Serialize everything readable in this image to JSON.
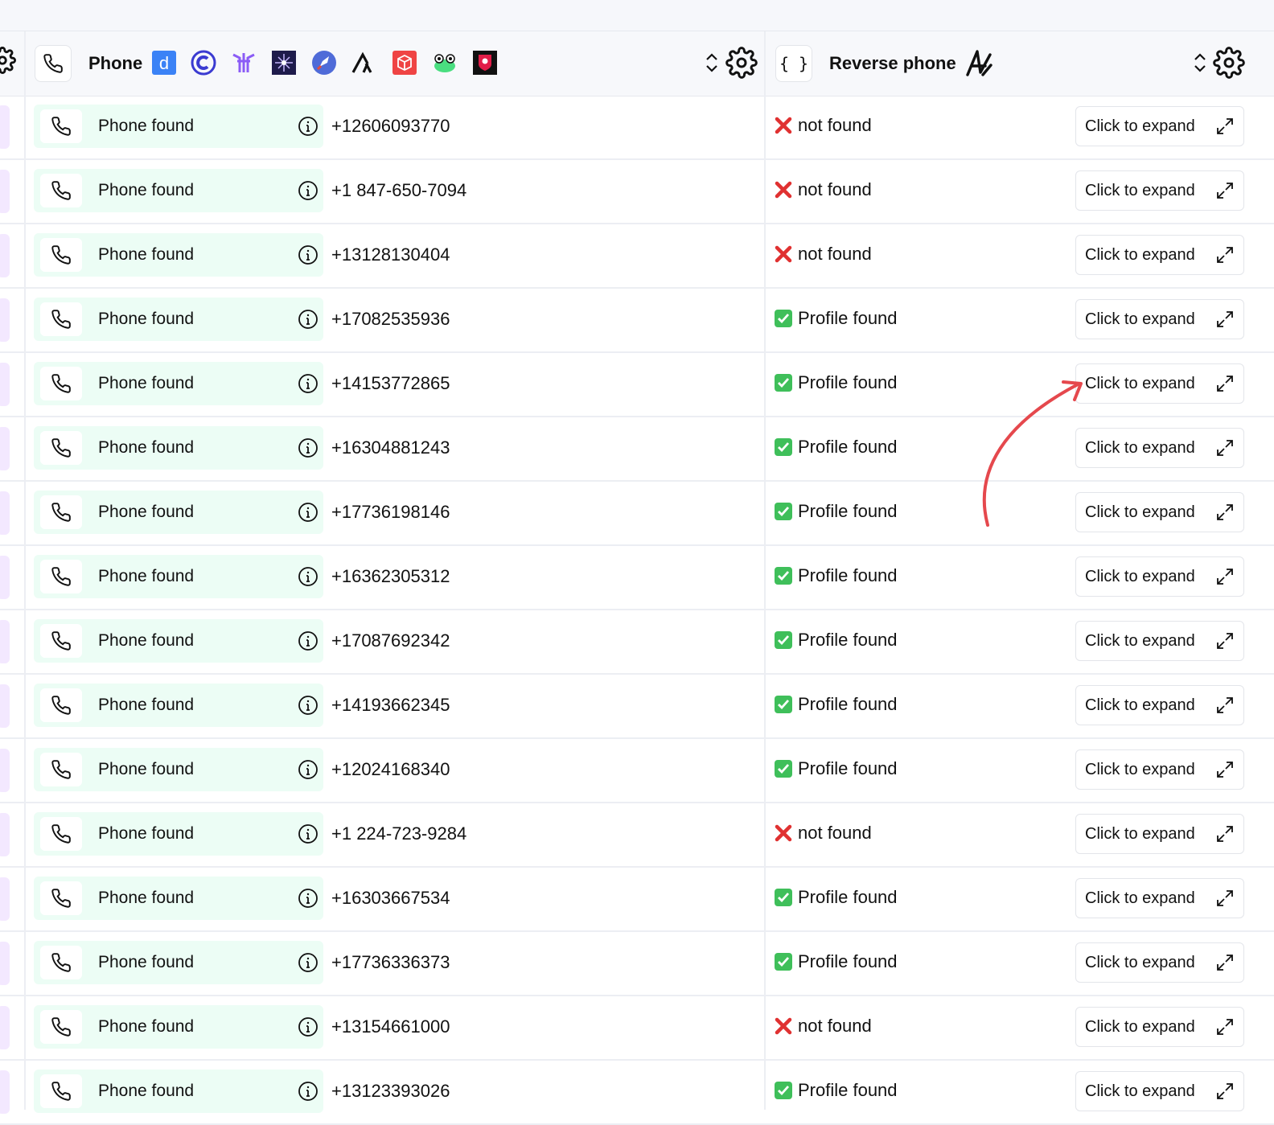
{
  "header": {
    "phone_title": "Phone",
    "reverse_title": "Reverse phone",
    "providers": [
      "d-logo-icon",
      "c-logo-icon",
      "trident-logo-icon",
      "star-logo-icon",
      "rocket-logo-icon",
      "triangle-logo-icon",
      "box-logo-icon",
      "frog-logo-icon",
      "shield-logo-icon"
    ]
  },
  "expand_label": "Click to expand",
  "rows": [
    {
      "phone_status": "Phone found",
      "phone": "+12606093770",
      "result": "not found",
      "found": false
    },
    {
      "phone_status": "Phone found",
      "phone": "+1 847-650-7094",
      "result": "not found",
      "found": false
    },
    {
      "phone_status": "Phone found",
      "phone": "+13128130404",
      "result": "not found",
      "found": false
    },
    {
      "phone_status": "Phone found",
      "phone": "+17082535936",
      "result": "Profile found",
      "found": true
    },
    {
      "phone_status": "Phone found",
      "phone": "+14153772865",
      "result": "Profile found",
      "found": true
    },
    {
      "phone_status": "Phone found",
      "phone": "+16304881243",
      "result": "Profile found",
      "found": true
    },
    {
      "phone_status": "Phone found",
      "phone": "+17736198146",
      "result": "Profile found",
      "found": true
    },
    {
      "phone_status": "Phone found",
      "phone": "+16362305312",
      "result": "Profile found",
      "found": true
    },
    {
      "phone_status": "Phone found",
      "phone": "+17087692342",
      "result": "Profile found",
      "found": true
    },
    {
      "phone_status": "Phone found",
      "phone": "+14193662345",
      "result": "Profile found",
      "found": true
    },
    {
      "phone_status": "Phone found",
      "phone": "+12024168340",
      "result": "Profile found",
      "found": true
    },
    {
      "phone_status": "Phone found",
      "phone": "+1 224-723-9284",
      "result": "not found",
      "found": false
    },
    {
      "phone_status": "Phone found",
      "phone": "+16303667534",
      "result": "Profile found",
      "found": true
    },
    {
      "phone_status": "Phone found",
      "phone": "+17736336373",
      "result": "Profile found",
      "found": true
    },
    {
      "phone_status": "Phone found",
      "phone": "+13154661000",
      "result": "not found",
      "found": false
    },
    {
      "phone_status": "Phone found",
      "phone": "+13123393026",
      "result": "Profile found",
      "found": true
    }
  ],
  "colors": {
    "pill_bg": "#ecfdf5",
    "check_green": "#3fbf5a",
    "cross_red": "#e03131",
    "arrow_red": "#e5484d"
  }
}
